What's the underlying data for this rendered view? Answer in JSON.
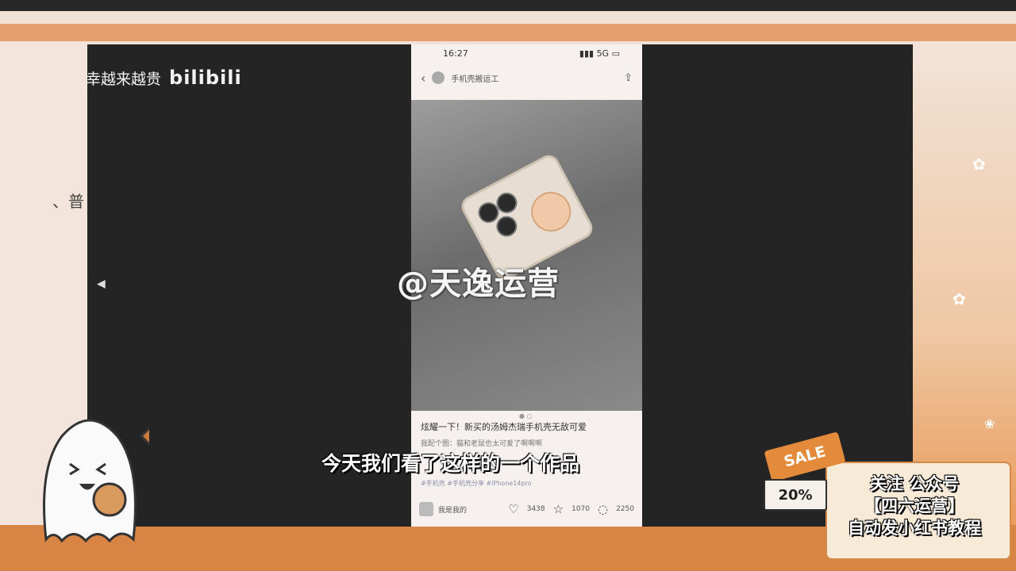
{
  "brand": {
    "tagline": "幸越来越贵",
    "logo": "bilibili"
  },
  "side_text": "、普",
  "phone": {
    "time": "16:27",
    "network": "5G",
    "account_name": "手机壳搬运工",
    "post_title": "炫耀一下！新买的汤姆杰瑞手机壳无敌可爱",
    "post_desc": "我配个图：猫和老鼠也太可爱了啊啊啊",
    "tags": "#手机壳 #手机壳分享 #iPhone14pro",
    "author": "我是我的",
    "likes": "3438",
    "favorites": "1070",
    "comments": "2250"
  },
  "watermark": "@天逸运营",
  "subtitle": "今天我们看了这样的一个作品",
  "ad": {
    "sale": "SALE",
    "discount": "20%",
    "line1": "关注 公众号",
    "line2": "【四六运营】",
    "line3": "自动发小红书教程"
  },
  "colors": {
    "accent": "#e38a3b",
    "video_bg": "#242424",
    "page_bg": "#f1e2d8"
  }
}
